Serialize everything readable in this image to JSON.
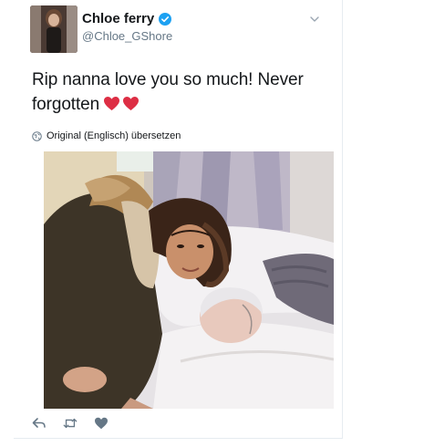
{
  "user": {
    "display_name": "Chloe ferry",
    "handle": "@Chloe_GShore",
    "verified": true
  },
  "tweet": {
    "text": "Rip nanna love you so much! Never forgotten",
    "emoji": [
      "red-heart",
      "red-heart"
    ],
    "translate_label": "Original (Englisch) übersetzen"
  },
  "icons": {
    "verified": "verified-badge-icon",
    "more": "chevron-down-icon",
    "globe": "globe-icon",
    "reply": "reply-icon",
    "retweet": "retweet-icon",
    "like": "heart-icon"
  },
  "colors": {
    "verified_blue": "#1da1f2",
    "icon_gray": "#657786",
    "heart_red": "#dd2e44"
  }
}
